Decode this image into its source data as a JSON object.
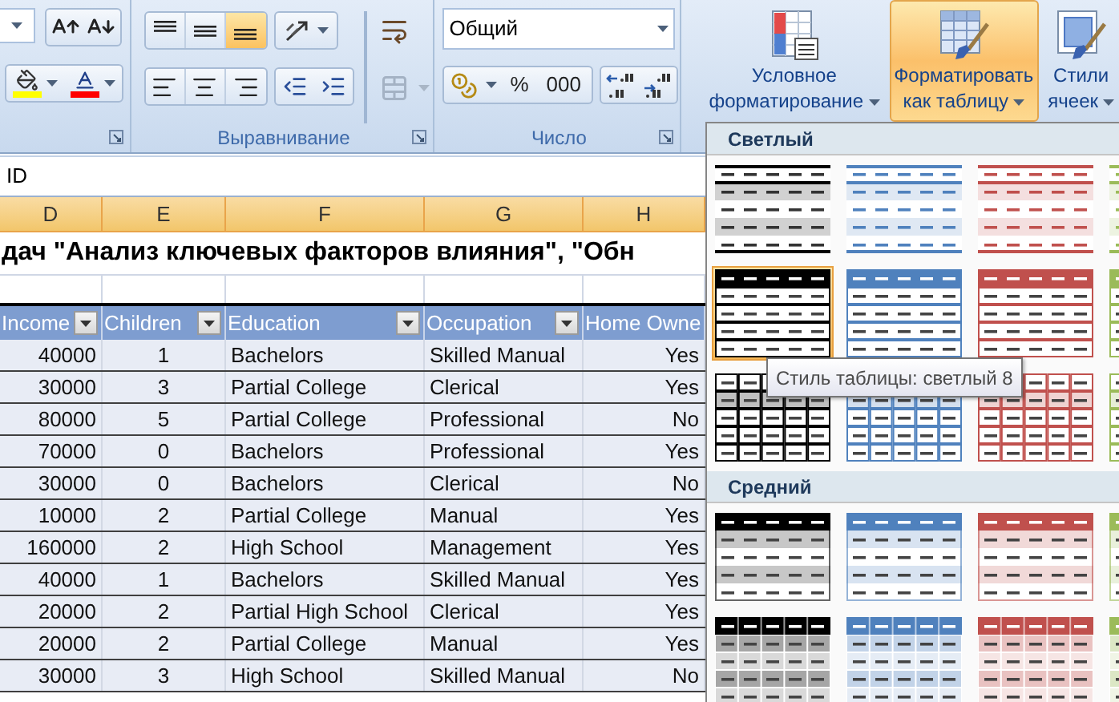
{
  "ribbon": {
    "font_group": {
      "size_buttons": [
        {
          "kind": "grow"
        },
        {
          "kind": "shrink"
        }
      ],
      "color_buttons": [
        {
          "kind": "fill",
          "color": "#ffff00"
        },
        {
          "kind": "font",
          "color": "#ff0000"
        }
      ]
    },
    "alignment_group": {
      "label": "Выравнивание",
      "vertical": [
        {
          "kind": "top",
          "selected": false
        },
        {
          "kind": "middle",
          "selected": false
        },
        {
          "kind": "bottom",
          "selected": true
        }
      ],
      "horizontal": [
        {
          "kind": "left",
          "selected": false
        },
        {
          "kind": "center",
          "selected": false
        },
        {
          "kind": "right",
          "selected": false
        }
      ]
    },
    "number_group": {
      "label": "Число",
      "format": "Общий",
      "buttons": [
        "%",
        "000"
      ]
    },
    "styles_group": {
      "buttons": [
        {
          "kind": "conditional",
          "lines": [
            "Условное",
            "форматирование"
          ],
          "selected": false
        },
        {
          "kind": "table",
          "lines": [
            "Форматировать",
            "как таблицу"
          ],
          "selected": true
        },
        {
          "kind": "cell",
          "lines": [
            "Стили",
            "ячеек"
          ],
          "selected": false
        }
      ]
    }
  },
  "formula_bar": {
    "value": "ID"
  },
  "sheet": {
    "columns": [
      {
        "label": "D",
        "selected": true
      },
      {
        "label": "E",
        "selected": true
      },
      {
        "label": "F",
        "selected": true
      },
      {
        "label": "G",
        "selected": true
      },
      {
        "label": "H",
        "selected": true
      }
    ],
    "title": "дач \"Анализ ключевых факторов влияния\", \"Обн",
    "table": {
      "columns": [
        {
          "label": "Income",
          "filter": true
        },
        {
          "label": "Children",
          "filter": true
        },
        {
          "label": "Education",
          "filter": true
        },
        {
          "label": "Occupation",
          "filter": true
        },
        {
          "label": "Home Owne",
          "filter": false
        }
      ],
      "rows": [
        [
          "40000",
          "1",
          "Bachelors",
          "Skilled Manual",
          "Yes"
        ],
        [
          "30000",
          "3",
          "Partial College",
          "Clerical",
          "Yes"
        ],
        [
          "80000",
          "5",
          "Partial College",
          "Professional",
          "No"
        ],
        [
          "70000",
          "0",
          "Bachelors",
          "Professional",
          "Yes"
        ],
        [
          "30000",
          "0",
          "Bachelors",
          "Clerical",
          "No"
        ],
        [
          "10000",
          "2",
          "Partial College",
          "Manual",
          "Yes"
        ],
        [
          "160000",
          "2",
          "High School",
          "Management",
          "Yes"
        ],
        [
          "40000",
          "1",
          "Bachelors",
          "Skilled Manual",
          "Yes"
        ],
        [
          "20000",
          "2",
          "Partial High School",
          "Clerical",
          "Yes"
        ],
        [
          "20000",
          "2",
          "Partial College",
          "Manual",
          "Yes"
        ],
        [
          "30000",
          "3",
          "High School",
          "Skilled Manual",
          "No"
        ]
      ]
    }
  },
  "gallery": {
    "sections": [
      {
        "title": "Светлый",
        "rows": [
          [
            {
              "kind": "light-banded",
              "color": "#000000",
              "selected": false
            },
            {
              "kind": "light-banded",
              "color": "#4f81bd",
              "selected": false
            },
            {
              "kind": "light-banded",
              "color": "#c0504d",
              "selected": false
            },
            {
              "kind": "light-banded",
              "color": "#9bbb59",
              "selected": false
            }
          ],
          [
            {
              "kind": "light-header",
              "color": "#000000",
              "selected": true
            },
            {
              "kind": "light-header",
              "color": "#4f81bd",
              "selected": false
            },
            {
              "kind": "light-header",
              "color": "#c0504d",
              "selected": false
            },
            {
              "kind": "light-header",
              "color": "#9bbb59",
              "selected": false
            }
          ],
          [
            {
              "kind": "light-grid",
              "color": "#000000",
              "selected": false
            },
            {
              "kind": "light-grid",
              "color": "#4f81bd",
              "selected": false
            },
            {
              "kind": "light-grid",
              "color": "#c0504d",
              "selected": false
            },
            {
              "kind": "light-grid",
              "color": "#9bbb59",
              "selected": false
            }
          ]
        ]
      },
      {
        "title": "Средний",
        "rows": [
          [
            {
              "kind": "medium-banded",
              "color": "#000000",
              "selected": false
            },
            {
              "kind": "medium-banded",
              "color": "#4f81bd",
              "selected": false
            },
            {
              "kind": "medium-banded",
              "color": "#c0504d",
              "selected": false
            },
            {
              "kind": "medium-banded",
              "color": "#9bbb59",
              "selected": false
            }
          ],
          [
            {
              "kind": "medium-grid",
              "color": "#000000",
              "selected": false
            },
            {
              "kind": "medium-grid",
              "color": "#4f81bd",
              "selected": false
            },
            {
              "kind": "medium-grid",
              "color": "#c0504d",
              "selected": false
            },
            {
              "kind": "medium-grid",
              "color": "#9bbb59",
              "selected": false
            }
          ]
        ]
      }
    ],
    "tooltip": "Стиль таблицы: светлый 8"
  }
}
